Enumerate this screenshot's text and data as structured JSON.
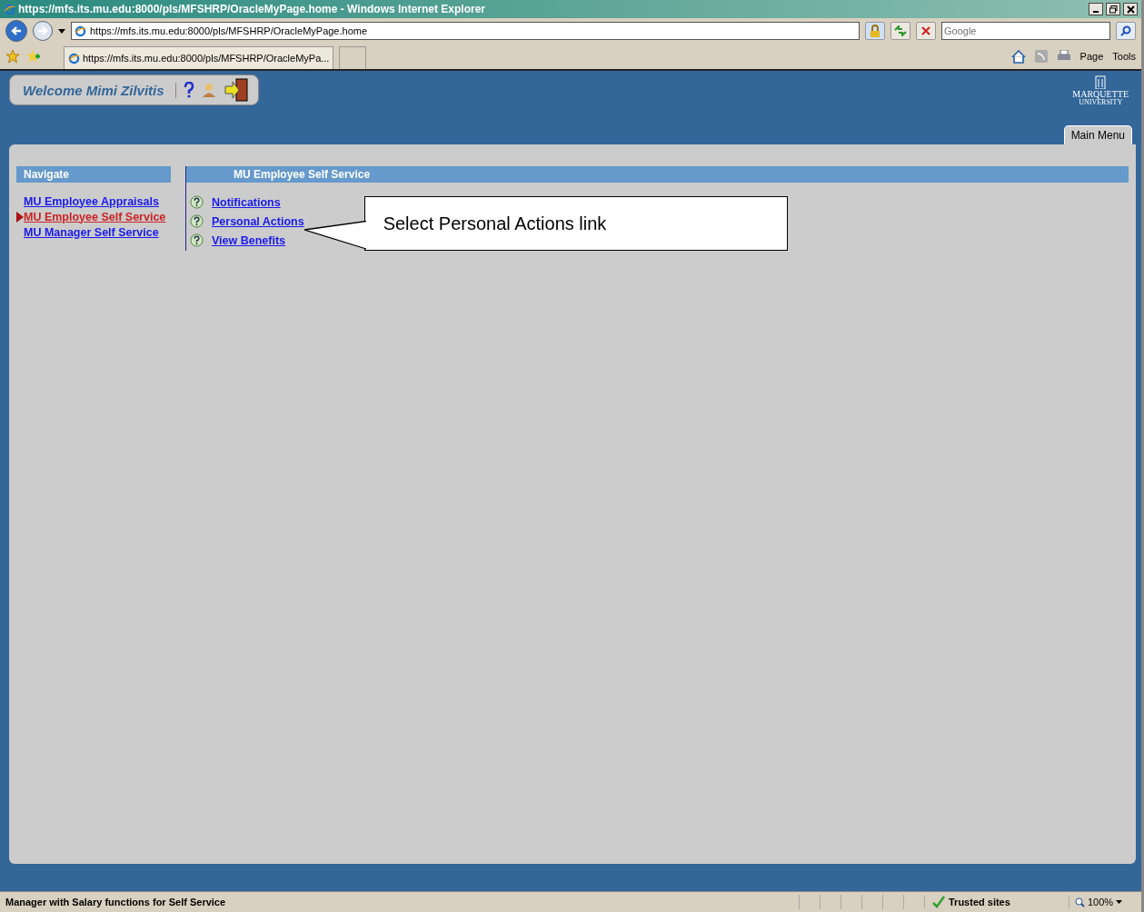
{
  "window": {
    "title": "https://mfs.its.mu.edu:8000/pls/MFSHRP/OracleMyPage.home - Windows Internet Explorer"
  },
  "address_bar": {
    "url": "https://mfs.its.mu.edu:8000/pls/MFSHRP/OracleMyPage.home"
  },
  "search": {
    "placeholder": "Google"
  },
  "tabs": [
    {
      "label": "https://mfs.its.mu.edu:8000/pls/MFSHRP/OracleMyPa...",
      "selected": true
    }
  ],
  "command_bar": [
    "Page",
    "Tools"
  ],
  "header": {
    "welcome": "Welcome Mimi Zilvitis",
    "logo": [
      "MARQUETTE",
      "UNIVERSITY"
    ]
  },
  "page_tab": {
    "label": "Main Menu",
    "selected": true
  },
  "navigate": {
    "title": "Navigate",
    "items": [
      {
        "label": "MU Employee Appraisals",
        "selected": false
      },
      {
        "label": "MU Employee Self Service",
        "selected": true
      },
      {
        "label": "MU Manager Self Service",
        "selected": false
      }
    ]
  },
  "content": {
    "title": "MU Employee Self Service",
    "links": [
      "Notifications",
      "Personal Actions",
      "View Benefits"
    ]
  },
  "callout": {
    "text": "Select Personal Actions link"
  },
  "status_bar": {
    "message": "Manager with Salary functions for Self Service",
    "zone": "Trusted sites",
    "zoom": "100%"
  }
}
